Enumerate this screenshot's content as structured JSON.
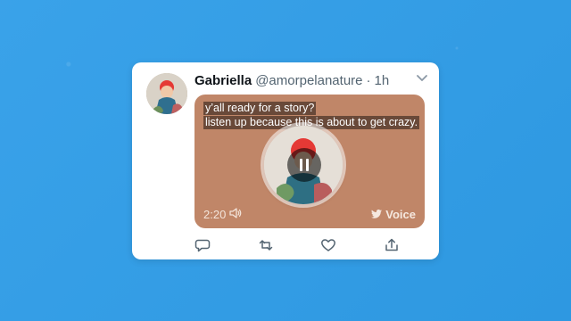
{
  "tweet": {
    "name": "Gabriella",
    "handle": "@amorpelanature",
    "separator": "·",
    "time": "1h",
    "caption_lines": [
      "y’all ready for a story?",
      "listen up because this is about to get crazy."
    ],
    "voice": {
      "duration": "2:20",
      "brand_label": "Voice"
    }
  },
  "colors": {
    "background": "#2f9de8",
    "voice_card": "#c08668",
    "card": "#ffffff",
    "accent_icon": "#536471"
  },
  "icons": {
    "chevron": "chevron-down-icon",
    "pause": "pause-icon",
    "volume": "volume-icon",
    "twitter": "twitter-bird-icon",
    "reply": "reply-icon",
    "retweet": "retweet-icon",
    "like": "heart-icon",
    "share": "share-icon"
  }
}
